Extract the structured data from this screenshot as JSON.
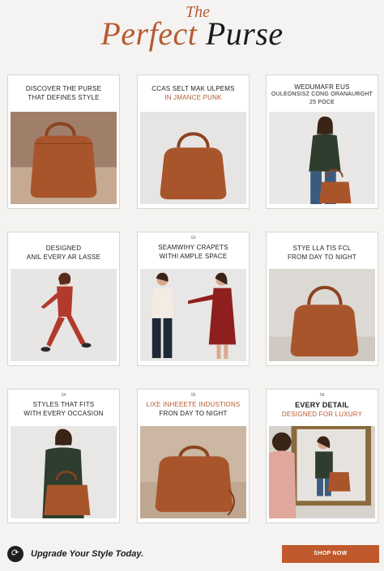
{
  "header": {
    "the": "The",
    "title_word1": "Perfect",
    "title_word2": "Purse"
  },
  "cards": [
    {
      "num": "",
      "line1": "DISCOVER THE PURSE",
      "line2": "THAT DEFINES STYLE"
    },
    {
      "num": "",
      "line1": "CCAS SELT MAK ULPEMS",
      "line2": "IN JMANCE PUNK"
    },
    {
      "num": "",
      "line1": "WEDUMAFR EUS",
      "line2": "OULEONSISZ CONG ORANAURGHT",
      "line3": "25 POCE"
    },
    {
      "num": "",
      "line1": "DESIGNED",
      "line2": "ANIL EVERY AR LASSE"
    },
    {
      "num": "S3",
      "line1": "SEAMWIHY CRAPETS",
      "line2": "WITHI AMPLE SPACE"
    },
    {
      "num": "",
      "line1": "STYE LLA TIS FCL",
      "line2": "FROM DAY TO NIGHT"
    },
    {
      "num": "S4",
      "line1": "STYLES THAT FITS",
      "line2": "WITH EVERY OCCASION"
    },
    {
      "num": "S5",
      "line1": "LIXE INHEEETE INDUSTIONS",
      "line2": "FRON DAY TO NIGHT"
    },
    {
      "num": "S6",
      "line1": "EVERY DETAIL",
      "line2": "DESIGNED FOR LUXURY"
    }
  ],
  "footer": {
    "tagline": "Upgrade Your Style Today.",
    "cta": "SHOP NOW",
    "logo_glyph": "⟳"
  },
  "colors": {
    "accent": "#b65a30",
    "bag": "#a9552b",
    "button": "#c05a2c"
  }
}
